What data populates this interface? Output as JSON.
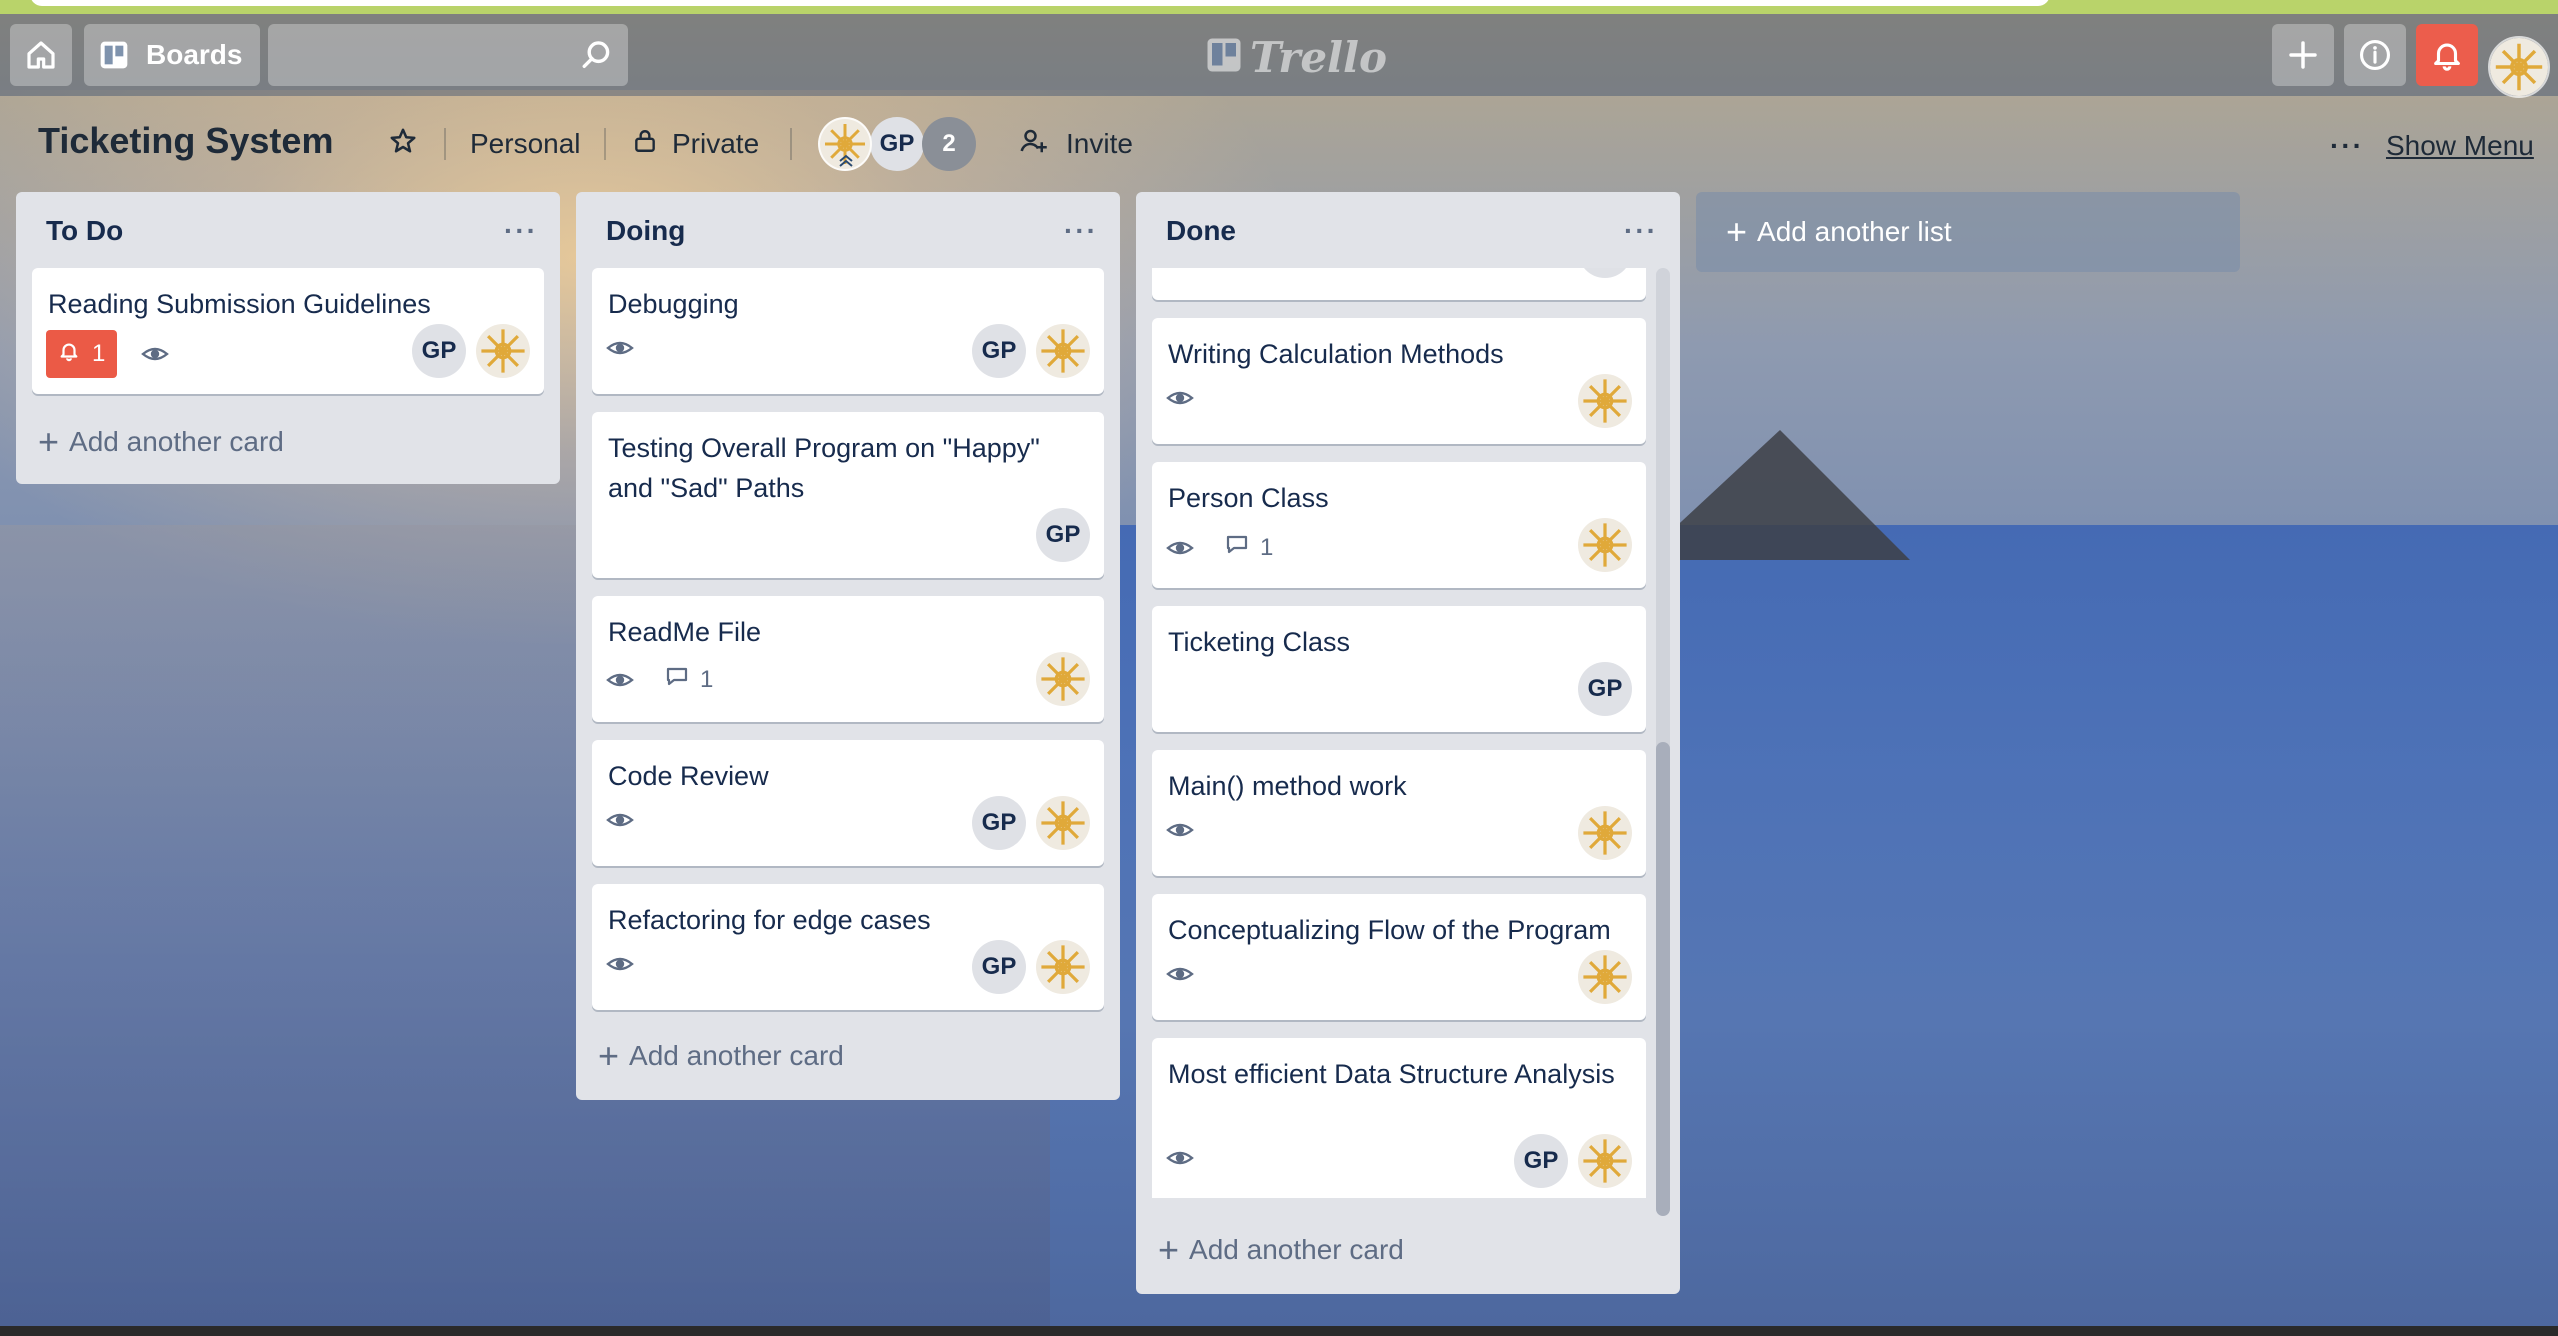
{
  "header": {
    "boards_label": "Boards",
    "logo_text": "Trello",
    "icons": {
      "home": "home-icon",
      "boards": "board-icon",
      "search": "search-icon",
      "add": "plus-icon",
      "info": "info-icon",
      "notifications": "bell-icon"
    }
  },
  "board": {
    "title": "Ticketing System",
    "team": "Personal",
    "visibility": "Private",
    "member_initials": "GP",
    "extra_members_count": "2",
    "invite_label": "Invite",
    "show_menu_label": "Show Menu"
  },
  "lists": [
    {
      "title": "To Do",
      "add_card_label": "Add another card",
      "cards": [
        {
          "title": "Reading Submission Guidelines",
          "due_badge": "1",
          "members": [
            "GP",
            "avatar"
          ]
        }
      ]
    },
    {
      "title": "Doing",
      "add_card_label": "Add another card",
      "cards": [
        {
          "title": "Debugging",
          "members": [
            "GP",
            "avatar"
          ]
        },
        {
          "title": "Testing Overall Program on \"Happy\" and \"Sad\" Paths",
          "members": [
            "GP"
          ]
        },
        {
          "title": "ReadMe File",
          "comments": "1",
          "members": [
            "avatar"
          ]
        },
        {
          "title": "Code Review",
          "members": [
            "GP",
            "avatar"
          ]
        },
        {
          "title": "Refactoring for edge cases",
          "members": [
            "GP",
            "avatar"
          ]
        }
      ]
    },
    {
      "title": "Done",
      "add_card_label": "Add another card",
      "cards": [
        {
          "title": "Writing Calculation Methods",
          "members": [
            "avatar"
          ]
        },
        {
          "title": "Person Class",
          "comments": "1",
          "members": [
            "avatar"
          ]
        },
        {
          "title": "Ticketing Class",
          "members": [
            "GP"
          ]
        },
        {
          "title": "Main() method work",
          "members": [
            "avatar"
          ]
        },
        {
          "title": "Conceptualizing Flow of the Program",
          "members": [
            "avatar"
          ]
        },
        {
          "title": "Most efficient Data Structure Analysis",
          "members": [
            "GP",
            "avatar"
          ]
        }
      ]
    }
  ],
  "add_list_label": "Add another list",
  "colors": {
    "alert": "#eb5a46",
    "notif_button": "#ec5d4c",
    "list_bg": "#e1e3e8",
    "title_text": "#172b4d"
  }
}
